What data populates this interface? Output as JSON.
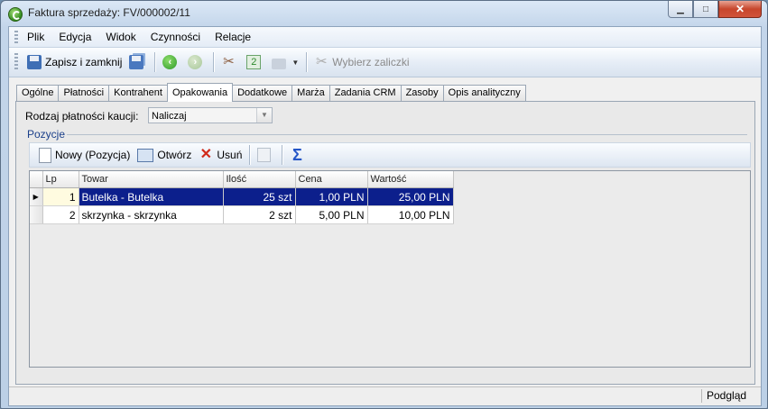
{
  "window": {
    "title": "Faktura sprzedaży: FV/000002/11"
  },
  "menu": [
    {
      "label": "Plik"
    },
    {
      "label": "Edycja"
    },
    {
      "label": "Widok"
    },
    {
      "label": "Czynności"
    },
    {
      "label": "Relacje"
    }
  ],
  "toolbar": {
    "save_close_label": "Zapisz i zamknij",
    "advances_label": "Wybierz zaliczki"
  },
  "tabs": [
    {
      "label": "Ogólne"
    },
    {
      "label": "Płatności"
    },
    {
      "label": "Kontrahent"
    },
    {
      "label": "Opakowania",
      "active": true
    },
    {
      "label": "Dodatkowe"
    },
    {
      "label": "Marża"
    },
    {
      "label": "Zadania CRM"
    },
    {
      "label": "Zasoby"
    },
    {
      "label": "Opis analityczny"
    }
  ],
  "deposit": {
    "label": "Rodzaj płatności kaucji:",
    "value": "Naliczaj"
  },
  "positions": {
    "group_label": "Pozycje",
    "new_label": "Nowy (Pozycja)",
    "open_label": "Otwórz",
    "delete_label": "Usuń"
  },
  "grid": {
    "columns": [
      "Lp",
      "Towar",
      "Ilość",
      "Cena",
      "Wartość"
    ],
    "rows": [
      {
        "lp": "1",
        "towar": "Butelka - Butelka",
        "ilosc": "25 szt",
        "cena": "1,00 PLN",
        "wartosc": "25,00 PLN",
        "selected": true
      },
      {
        "lp": "2",
        "towar": "skrzynka - skrzynka",
        "ilosc": "2 szt",
        "cena": "5,00 PLN",
        "wartosc": "10,00 PLN",
        "selected": false
      }
    ]
  },
  "status": {
    "mode": "Podgląd"
  },
  "colors": {
    "selection": "#0c1f8c",
    "accent": "#1a3f8a",
    "close_button": "#c7462c"
  }
}
